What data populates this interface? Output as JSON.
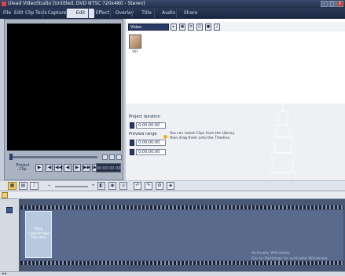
{
  "window": {
    "title": "Ulead VideoStudio [Untitled, DVD NTSC 720x480 - Stereo]"
  },
  "menu": {
    "items": [
      "File",
      "Edit",
      "Clip",
      "Tools"
    ]
  },
  "steps": [
    {
      "label": "Capture"
    },
    {
      "label": "Edit",
      "active": true
    },
    {
      "label": "Effect"
    },
    {
      "label": "Overlay"
    },
    {
      "label": "Title"
    },
    {
      "label": "Audio"
    },
    {
      "label": "Share"
    }
  ],
  "preview": {
    "mode_label_1": "Project",
    "mode_label_2": "Clip",
    "timecode": "00:00:00:00",
    "transport": [
      "▶",
      "|◀",
      "◀◀",
      "◀",
      "▶",
      "▶▶",
      "▶|",
      "⟲"
    ]
  },
  "library": {
    "category": "Video",
    "thumb_label": "V01",
    "icons": [
      "folder-icon",
      "clip-icon",
      "list-icon",
      "options-icon",
      "play-icon",
      "arrow-down-icon"
    ]
  },
  "options": {
    "project_duration_label": "Project duration",
    "project_duration": "0:00:00:00",
    "preview_range_label": "Preview range",
    "preview_start": "0:00:00:00",
    "preview_end": "0:00:00:00",
    "hint": "You can select Clips from the Library then drag them onto the Timeline."
  },
  "timeline": {
    "drop_text": "Drag video/Image Clip Here"
  },
  "activation": {
    "line1": "Activate Windows",
    "line2": "Go to Settings to activate Windows."
  },
  "colors": {
    "accent": "#2a3a66",
    "highlight": "#f2d070"
  }
}
